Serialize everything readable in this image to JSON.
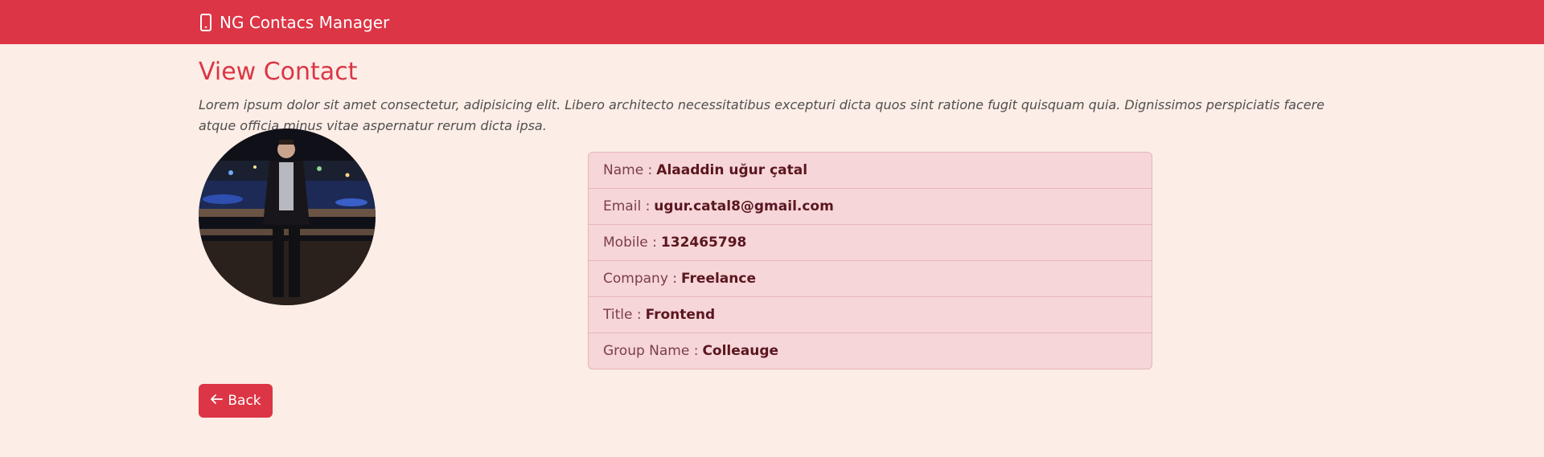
{
  "navbar": {
    "brand_icon": "phone-icon",
    "brand_label": "NG Contacs Manager"
  },
  "page": {
    "title": "View Contact",
    "description": "Lorem ipsum dolor sit amet consectetur, adipisicing elit. Libero architecto necessitatibus excepturi dicta quos sint ratione fugit quisquam quia. Dignissimos perspiciatis facere atque officia minus vitae aspernatur rerum dicta ipsa."
  },
  "contact": {
    "fields": [
      {
        "label": "Name :",
        "value": "Alaaddin uğur çatal"
      },
      {
        "label": "Email :",
        "value": "ugur.catal8@gmail.com"
      },
      {
        "label": "Mobile :",
        "value": "132465798"
      },
      {
        "label": "Company :",
        "value": "Freelance"
      },
      {
        "label": "Title :",
        "value": "Frontend"
      },
      {
        "label": "Group Name :",
        "value": "Colleauge"
      }
    ]
  },
  "actions": {
    "back_icon": "arrow-left-icon",
    "back_label": "Back"
  },
  "colors": {
    "primary": "#dc3545",
    "background": "#fcede6",
    "list_background": "#f6d6d8"
  }
}
